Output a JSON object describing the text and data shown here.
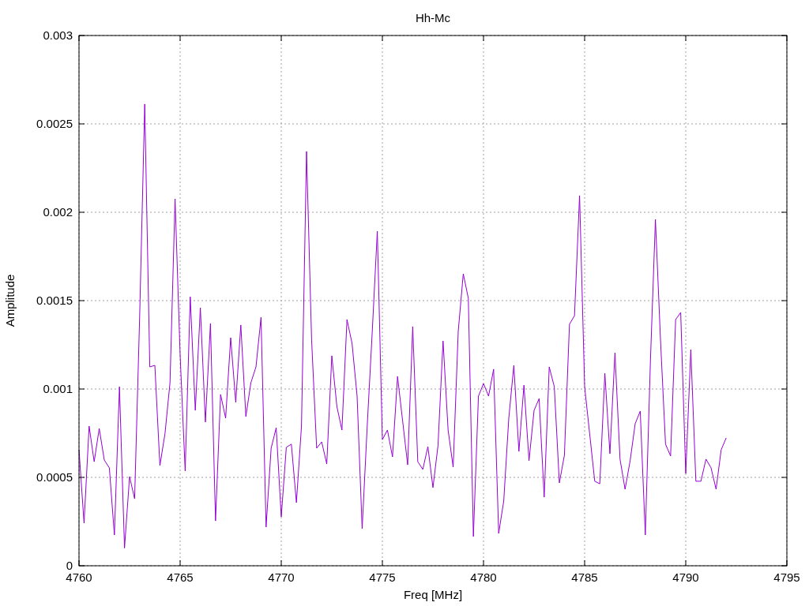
{
  "chart": {
    "chart_data": {
      "type": "line",
      "title": "Hh-Mc",
      "xlabel": "Freq [MHz]",
      "ylabel": "Amplitude",
      "xlim": [
        4760,
        4795
      ],
      "ylim": [
        0,
        0.003
      ],
      "xticks": [
        4760,
        4765,
        4770,
        4775,
        4780,
        4785,
        4790,
        4795
      ],
      "yticks": [
        0,
        0.0005,
        0.001,
        0.0015,
        0.002,
        0.0025,
        0.003
      ],
      "grid": true,
      "x": [
        4760,
        4760.25,
        4760.5,
        4760.75,
        4761,
        4761.25,
        4761.5,
        4761.75,
        4762,
        4762.25,
        4762.5,
        4762.75,
        4763,
        4763.25,
        4763.5,
        4763.75,
        4764,
        4764.25,
        4764.5,
        4764.75,
        4765,
        4765.25,
        4765.5,
        4765.75,
        4766,
        4766.25,
        4766.5,
        4766.75,
        4767,
        4767.25,
        4767.5,
        4767.75,
        4768,
        4768.25,
        4768.5,
        4768.75,
        4769,
        4769.25,
        4769.5,
        4769.75,
        4770,
        4770.25,
        4770.5,
        4770.75,
        4771,
        4771.25,
        4771.5,
        4771.75,
        4772,
        4772.25,
        4772.5,
        4772.75,
        4773,
        4773.25,
        4773.5,
        4773.75,
        4774,
        4774.25,
        4774.5,
        4774.75,
        4775,
        4775.25,
        4775.5,
        4775.75,
        4776,
        4776.25,
        4776.5,
        4776.75,
        4777,
        4777.25,
        4777.5,
        4777.75,
        4778,
        4778.25,
        4778.5,
        4778.75,
        4779,
        4779.25,
        4779.5,
        4779.75,
        4780,
        4780.25,
        4780.5,
        4780.75,
        4781,
        4781.25,
        4781.5,
        4781.75,
        4782,
        4782.25,
        4782.5,
        4782.75,
        4783,
        4783.25,
        4783.5,
        4783.75,
        4784,
        4784.25,
        4784.5,
        4784.75,
        4785,
        4785.25,
        4785.5,
        4785.75,
        4786,
        4786.25,
        4786.5,
        4786.75,
        4787,
        4787.25,
        4787.5,
        4787.75,
        4788,
        4788.25,
        4788.5,
        4788.75,
        4789,
        4789.25,
        4789.5,
        4789.75,
        4790,
        4790.25,
        4790.5,
        4790.75,
        4791,
        4791.25,
        4791.5,
        4791.75,
        4792
      ],
      "series": [
        {
          "color": "#9400d3",
          "values": [
            0.000656,
            0.000241,
            0.00079,
            0.000589,
            0.000777,
            0.000598,
            0.000554,
            0.000174,
            0.001013,
            0.0001,
            0.000504,
            0.000379,
            0.001415,
            0.002612,
            0.001125,
            0.001134,
            0.000567,
            0.000746,
            0.001036,
            0.002076,
            0.001192,
            0.000536,
            0.001522,
            0.000879,
            0.00146,
            0.000813,
            0.001371,
            0.000254,
            0.000969,
            0.000835,
            0.00129,
            0.000924,
            0.001362,
            0.000844,
            0.001036,
            0.001125,
            0.001406,
            0.000219,
            0.000665,
            0.000781,
            0.000277,
            0.00067,
            0.000688,
            0.000357,
            0.00079,
            0.002344,
            0.001281,
            0.000665,
            0.000701,
            0.000576,
            0.001188,
            0.000902,
            0.000768,
            0.001393,
            0.001259,
            0.00096,
            0.00021,
            0.00079,
            0.001326,
            0.001893,
            0.000714,
            0.000768,
            0.000616,
            0.001071,
            0.000821,
            0.000571,
            0.001353,
            0.000589,
            0.000545,
            0.000674,
            0.000442,
            0.000679,
            0.001272,
            0.000768,
            0.000558,
            0.001326,
            0.001652,
            0.001513,
            0.000165,
            0.00096,
            0.001031,
            0.00096,
            0.001112,
            0.000183,
            0.000366,
            0.000835,
            0.001134,
            0.000647,
            0.001022,
            0.000594,
            0.000879,
            0.000946,
            0.000388,
            0.001125,
            0.001013,
            0.000469,
            0.000625,
            0.001366,
            0.001415,
            0.002094,
            0.001013,
            0.000746,
            0.000478,
            0.000464,
            0.001089,
            0.000634,
            0.001205,
            0.000603,
            0.000433,
            0.000594,
            0.000804,
            0.000875,
            0.000174,
            0.001147,
            0.00196,
            0.001281,
            0.000688,
            0.000621,
            0.001393,
            0.001433,
            0.000522,
            0.001223,
            0.000478,
            0.000478,
            0.000603,
            0.000554,
            0.000433,
            0.000656,
            0.000723
          ]
        }
      ]
    }
  }
}
